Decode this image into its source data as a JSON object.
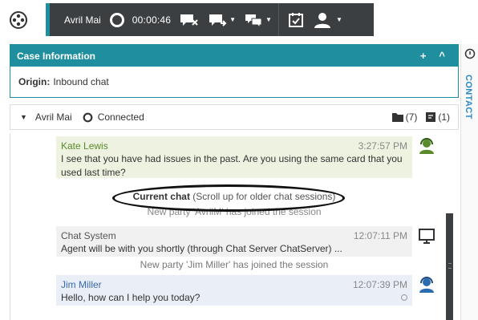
{
  "toolbar": {
    "agent_name": "Avril Mai",
    "timer": "00:00:46",
    "buttons": [
      {
        "icon": "end-chat-icon"
      },
      {
        "icon": "transfer-chat-icon"
      },
      {
        "icon": "consult-chat-icon"
      },
      {
        "icon": "mark-done-icon"
      },
      {
        "icon": "party-actions-icon"
      }
    ]
  },
  "case_info": {
    "title": "Case Information",
    "origin_label": "Origin:",
    "origin_value": "Inbound chat",
    "add_symbol": "+",
    "collapse_symbol": "^"
  },
  "side_tab": {
    "label": "CONTACT"
  },
  "interaction": {
    "party_name": "Avril Mai",
    "status": "Connected",
    "folder_count": "(7)",
    "notes_count": "(1)"
  },
  "transcript": {
    "messages": [
      {
        "sender": "Kate Lewis",
        "time": "3:27:57 PM",
        "text": "I see that you have had issues in the past. Are you using the same card that you used last time?"
      },
      {
        "sender": "Chat System",
        "time": "12:07:11 PM",
        "text": "Agent will be with you shortly (through Chat Server ChatServer) ..."
      },
      {
        "sender": "Jim Miller",
        "time": "12:07:39 PM",
        "text": "Hello, how can I help you today?"
      }
    ],
    "current_chat_bold": "Current chat",
    "current_chat_rest": " (Scroll up for older chat sessions)",
    "joined_avril": "New party 'AvrilM' has joined the session",
    "joined_jim": "New party 'Jim Miller' has joined the session"
  },
  "colors": {
    "toolbar_bg": "#3c3f42",
    "accent": "#1f8fa0",
    "agent_message_bg": "#eef2e1",
    "system_message_bg": "#f1f1f1",
    "customer_message_bg": "#e9eef7",
    "contact_tab": "#2b86c5"
  }
}
